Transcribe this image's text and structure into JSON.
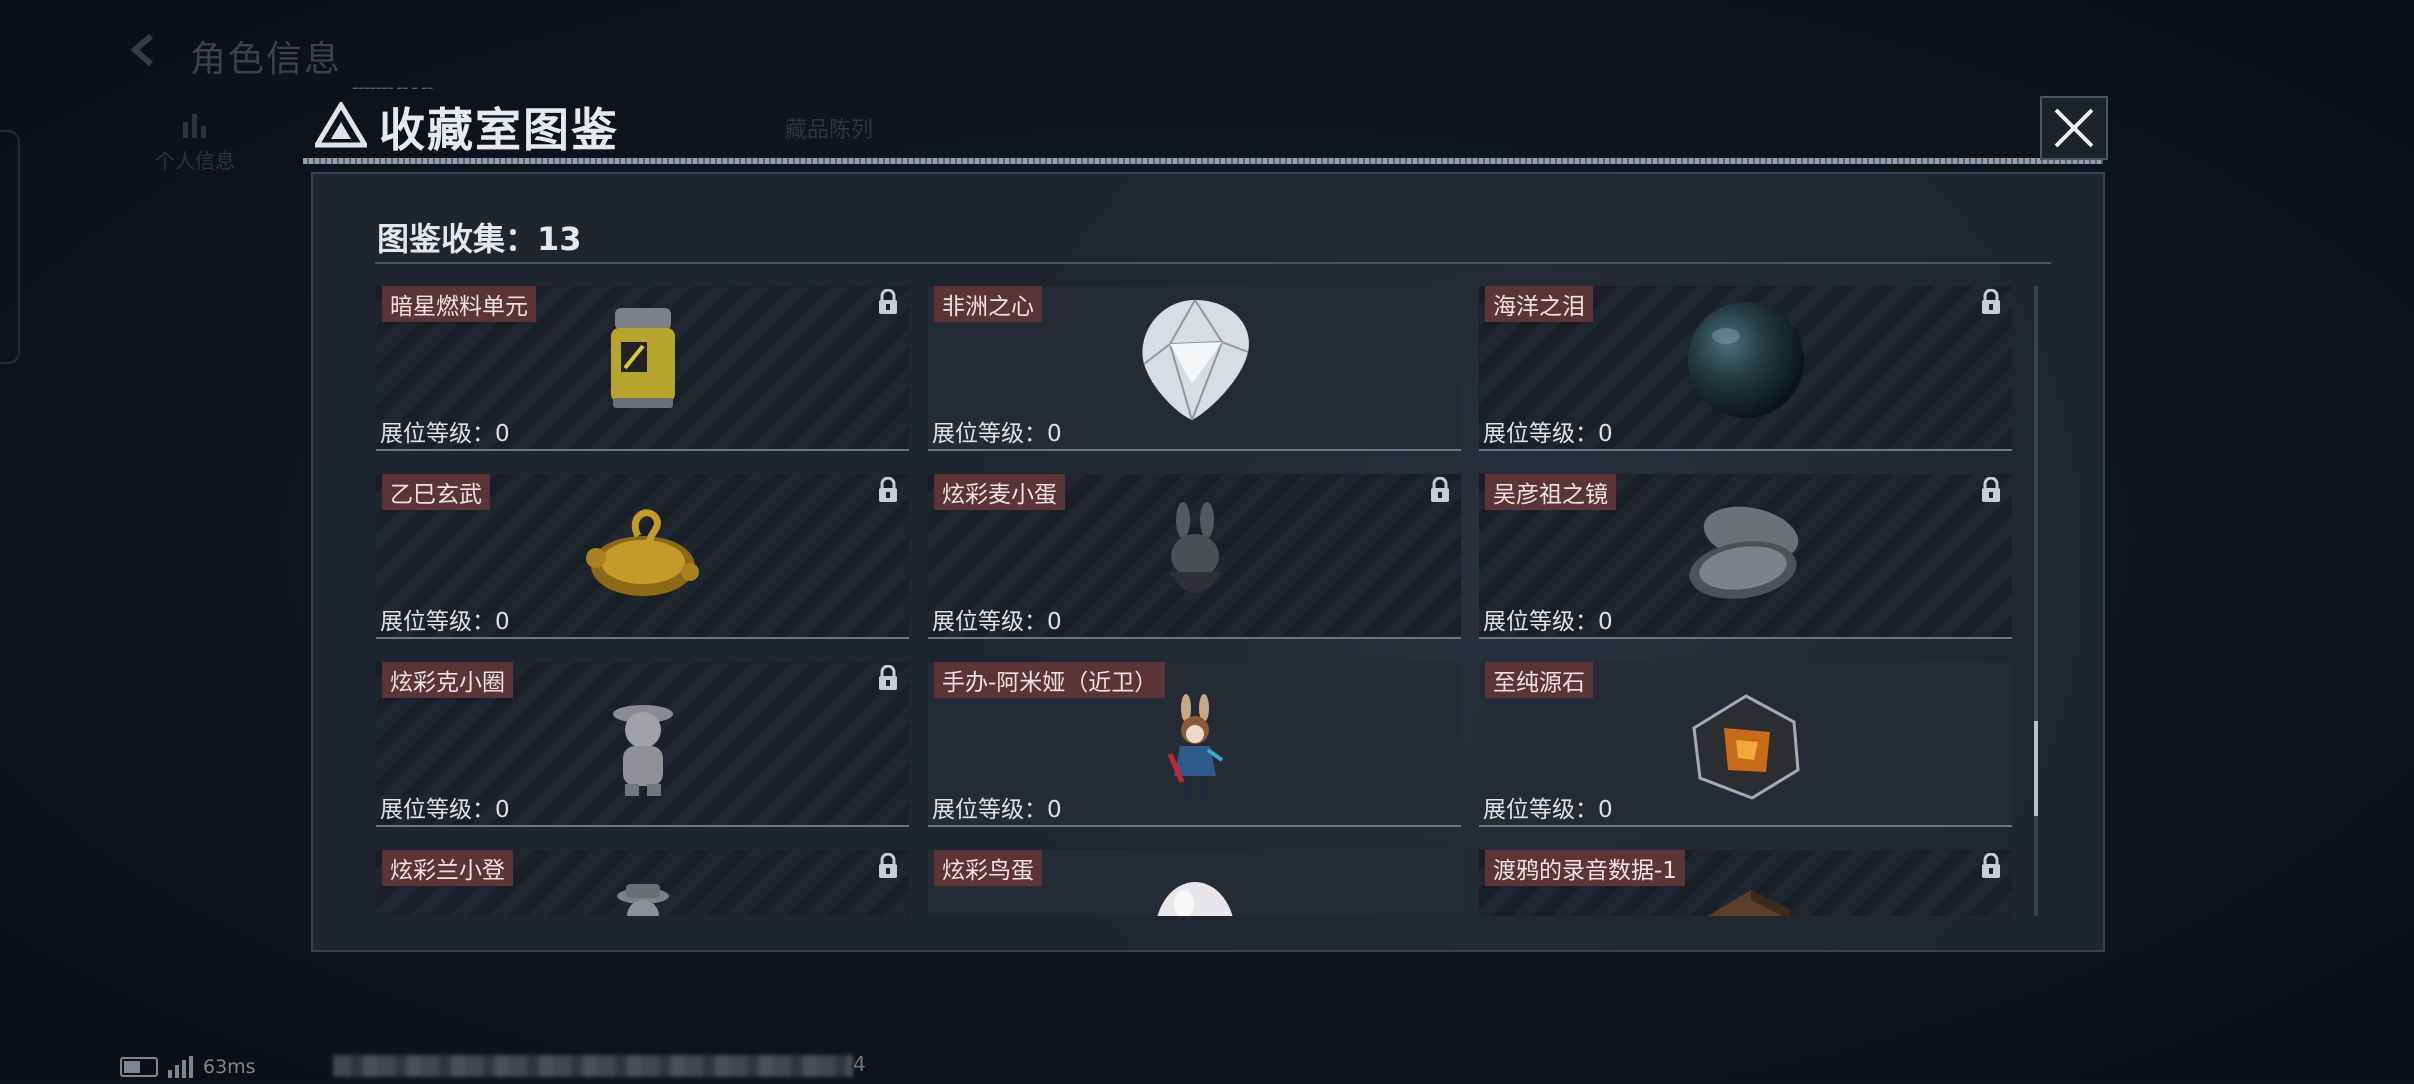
{
  "background": {
    "title": "角色信息",
    "sidebar": [
      "个人信息",
      "",
      "",
      "",
      "",
      "",
      ""
    ],
    "tab": "藏品陈列"
  },
  "modal": {
    "title": "收藏室图鉴",
    "collection_label": "图鉴收集：13",
    "level_label": "展位等级：0",
    "items": [
      {
        "name": "暗星燃料单元",
        "locked": true,
        "art": "fuel-canister"
      },
      {
        "name": "非洲之心",
        "locked": false,
        "art": "diamond"
      },
      {
        "name": "海洋之泪",
        "locked": true,
        "art": "dark-pearl"
      },
      {
        "name": "乙巳玄武",
        "locked": true,
        "art": "golden-turtle"
      },
      {
        "name": "炫彩麦小蛋",
        "locked": true,
        "art": "bunny-egg"
      },
      {
        "name": "吴彦祖之镜",
        "locked": true,
        "art": "compact-mirror"
      },
      {
        "name": "炫彩克小圈",
        "locked": true,
        "art": "figurine"
      },
      {
        "name": "手办-阿米娅（近卫）",
        "locked": false,
        "art": "amiya-figure"
      },
      {
        "name": "至纯源石",
        "locked": false,
        "art": "originium"
      },
      {
        "name": "炫彩兰小登",
        "locked": true,
        "art": "hat-figure"
      },
      {
        "name": "炫彩鸟蛋",
        "locked": false,
        "art": "pearl-egg"
      },
      {
        "name": "渡鸦的录音数据-1",
        "locked": true,
        "art": "recorder"
      }
    ]
  },
  "statusbar": {
    "ping": "63ms",
    "trailing": "4"
  },
  "colors": {
    "name_tag_bg": "#5b3437",
    "panel_bg": "#1f252e",
    "page_bg": "#0e1219"
  }
}
